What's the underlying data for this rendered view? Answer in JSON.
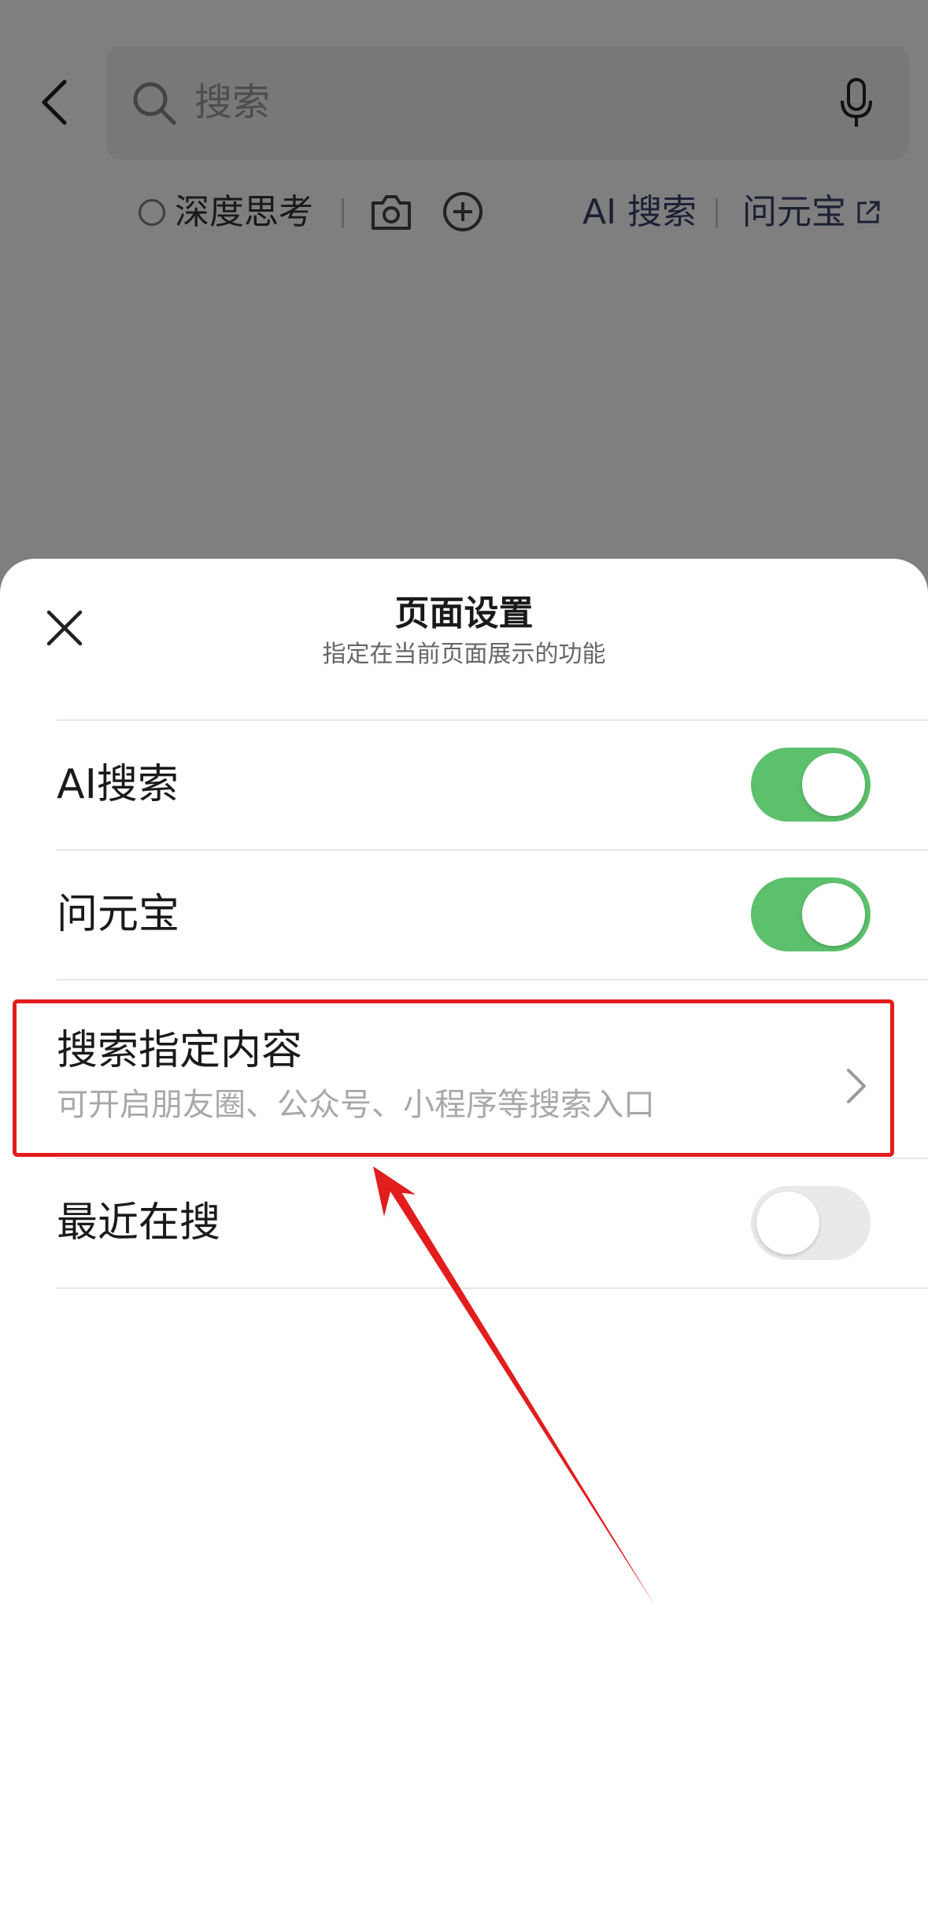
{
  "search": {
    "placeholder": "搜索"
  },
  "tools": {
    "deep_think": "深度思考",
    "ai_search": "AI 搜索",
    "yuanbao": "问元宝"
  },
  "sheet": {
    "title": "页面设置",
    "subtitle": "指定在当前页面展示的功能",
    "rows": [
      {
        "label": "AI搜索",
        "toggle": true
      },
      {
        "label": "问元宝",
        "toggle": true
      },
      {
        "label": "搜索指定内容",
        "sub": "可开启朋友圈、公众号、小程序等搜索入口"
      },
      {
        "label": "最近在搜",
        "toggle": false
      }
    ]
  },
  "colors": {
    "toggle_on": "#5cc06c",
    "toggle_off": "#e9e9e9",
    "highlight": "#e21d1d",
    "link_text": "#37406b"
  },
  "icons": [
    "back-icon",
    "search-icon",
    "mic-icon",
    "camera-icon",
    "plus-icon",
    "external-link-icon",
    "close-icon",
    "chevron-right-icon"
  ]
}
